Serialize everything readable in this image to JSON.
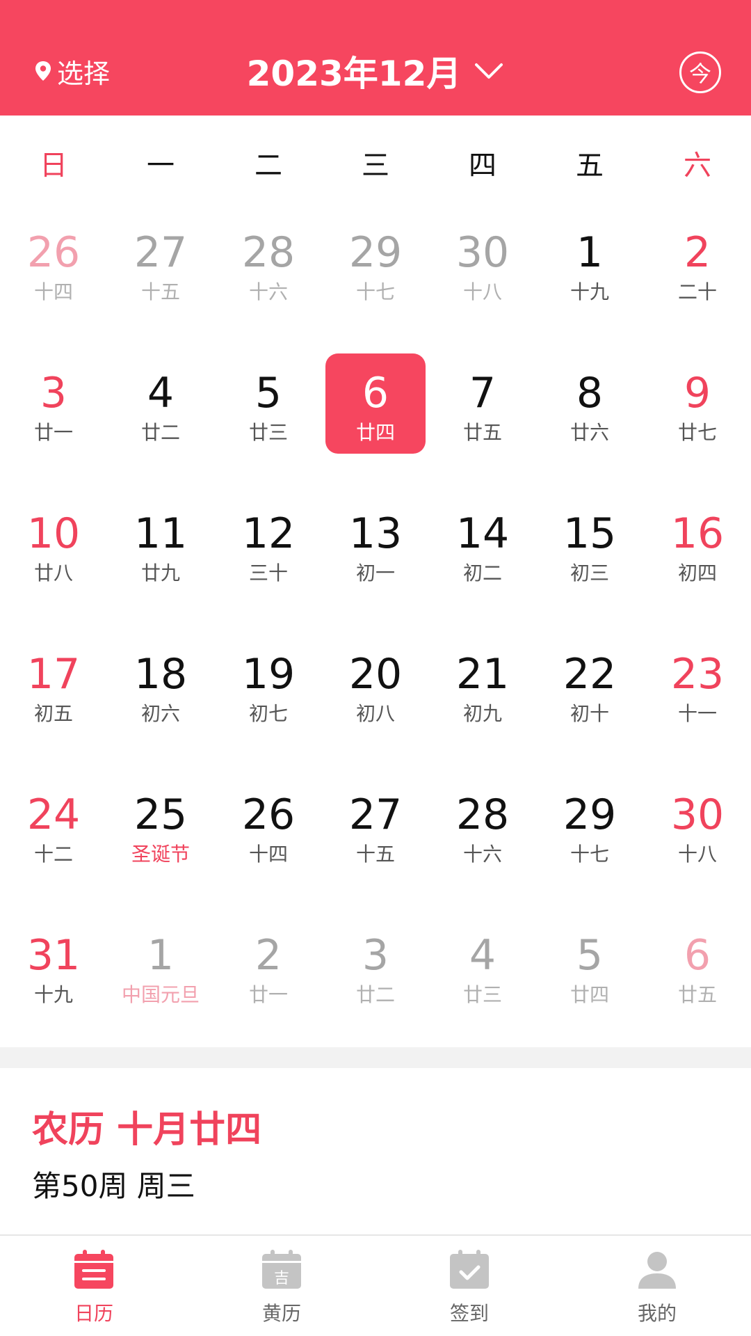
{
  "header": {
    "location_label": "选择",
    "month_title": "2023年12月",
    "today_label": "今"
  },
  "colors": {
    "accent": "#f6465f",
    "red_text": "#f0435c",
    "muted": "#a5a5a5",
    "pink_muted": "#f2a0ae"
  },
  "weekdays": [
    "日",
    "一",
    "二",
    "三",
    "四",
    "五",
    "六"
  ],
  "weeks": [
    [
      {
        "d": "26",
        "s": "十四"
      },
      {
        "d": "27",
        "s": "十五"
      },
      {
        "d": "28",
        "s": "十六"
      },
      {
        "d": "29",
        "s": "十七"
      },
      {
        "d": "30",
        "s": "十八"
      },
      {
        "d": "1",
        "s": "十九"
      },
      {
        "d": "2",
        "s": "二十"
      }
    ],
    [
      {
        "d": "3",
        "s": "廿一"
      },
      {
        "d": "4",
        "s": "廿二"
      },
      {
        "d": "5",
        "s": "廿三"
      },
      {
        "d": "6",
        "s": "廿四"
      },
      {
        "d": "7",
        "s": "廿五"
      },
      {
        "d": "8",
        "s": "廿六"
      },
      {
        "d": "9",
        "s": "廿七"
      }
    ],
    [
      {
        "d": "10",
        "s": "廿八"
      },
      {
        "d": "11",
        "s": "廿九"
      },
      {
        "d": "12",
        "s": "三十"
      },
      {
        "d": "13",
        "s": "初一"
      },
      {
        "d": "14",
        "s": "初二"
      },
      {
        "d": "15",
        "s": "初三"
      },
      {
        "d": "16",
        "s": "初四"
      }
    ],
    [
      {
        "d": "17",
        "s": "初五"
      },
      {
        "d": "18",
        "s": "初六"
      },
      {
        "d": "19",
        "s": "初七"
      },
      {
        "d": "20",
        "s": "初八"
      },
      {
        "d": "21",
        "s": "初九"
      },
      {
        "d": "22",
        "s": "初十"
      },
      {
        "d": "23",
        "s": "十一"
      }
    ],
    [
      {
        "d": "24",
        "s": "十二"
      },
      {
        "d": "25",
        "s": "圣诞节"
      },
      {
        "d": "26",
        "s": "十四"
      },
      {
        "d": "27",
        "s": "十五"
      },
      {
        "d": "28",
        "s": "十六"
      },
      {
        "d": "29",
        "s": "十七"
      },
      {
        "d": "30",
        "s": "十八"
      }
    ],
    [
      {
        "d": "31",
        "s": "十九"
      },
      {
        "d": "1",
        "s": "中国元旦"
      },
      {
        "d": "2",
        "s": "廿一"
      },
      {
        "d": "3",
        "s": "廿二"
      },
      {
        "d": "4",
        "s": "廿三"
      },
      {
        "d": "5",
        "s": "廿四"
      },
      {
        "d": "6",
        "s": "廿五"
      }
    ]
  ],
  "info": {
    "lunar_title": "农历 十月廿四",
    "week_line": "第50周 周三"
  },
  "tabs": [
    {
      "label": "日历",
      "icon": "calendar-icon",
      "active": true
    },
    {
      "label": "黄历",
      "icon": "almanac-icon",
      "active": false
    },
    {
      "label": "签到",
      "icon": "checkin-icon",
      "active": false
    },
    {
      "label": "我的",
      "icon": "profile-icon",
      "active": false
    }
  ]
}
